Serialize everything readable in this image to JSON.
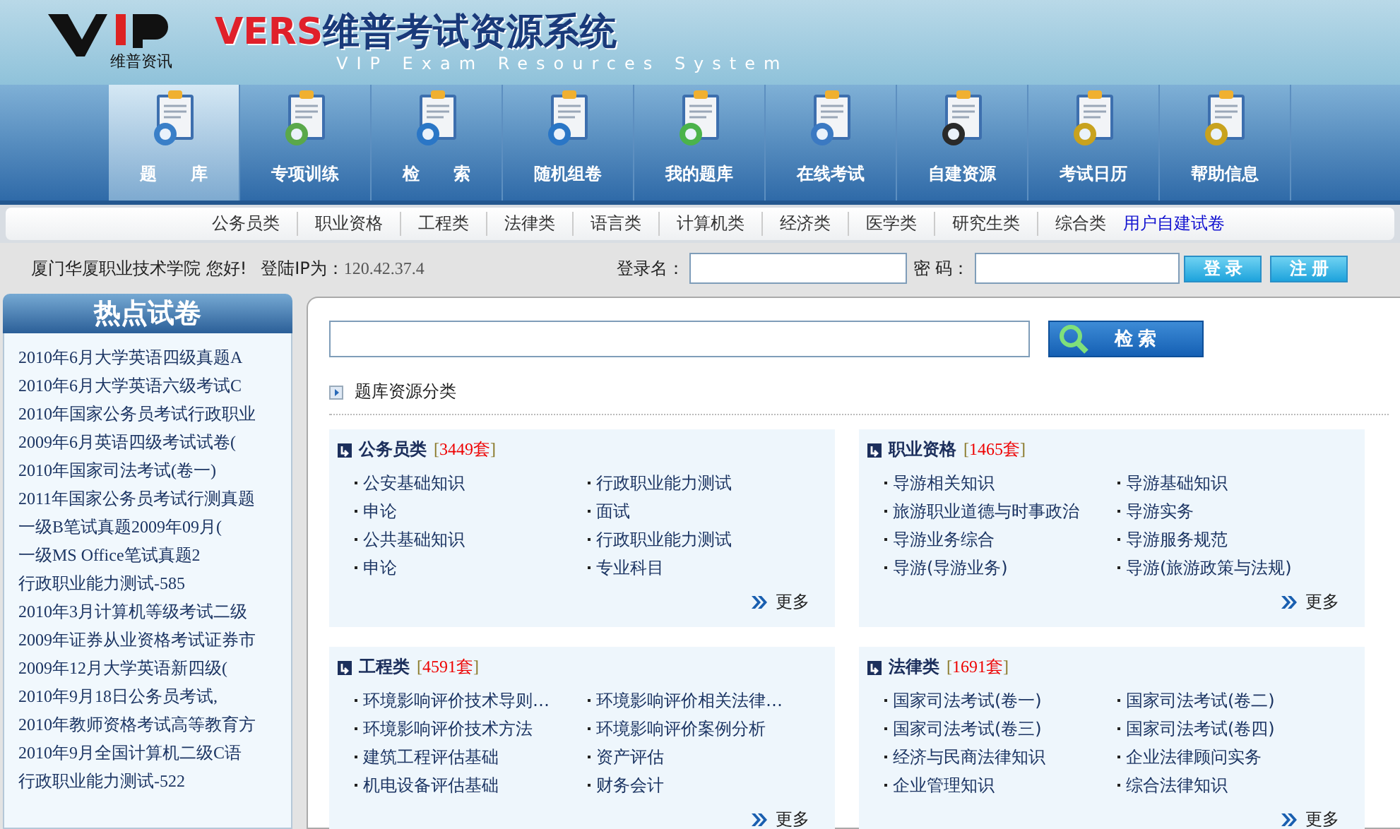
{
  "header": {
    "logo_text": "维普资讯",
    "title_latin": "VERS",
    "title_cn": "维普考试资源系统",
    "subtitle": "VIP Exam Resources System"
  },
  "nav": [
    {
      "label": "题　　库",
      "selected": true
    },
    {
      "label": "专项训练",
      "selected": false
    },
    {
      "label": "检　　索",
      "selected": false
    },
    {
      "label": "随机组卷",
      "selected": false
    },
    {
      "label": "我的题库",
      "selected": false
    },
    {
      "label": "在线考试",
      "selected": false
    },
    {
      "label": "自建资源",
      "selected": false
    },
    {
      "label": "考试日历",
      "selected": false
    },
    {
      "label": "帮助信息",
      "selected": false
    }
  ],
  "subnav": [
    {
      "label": "公务员类",
      "kind": "category"
    },
    {
      "label": "职业资格",
      "kind": "category"
    },
    {
      "label": "工程类",
      "kind": "category"
    },
    {
      "label": "法律类",
      "kind": "category"
    },
    {
      "label": "语言类",
      "kind": "category"
    },
    {
      "label": "计算机类",
      "kind": "category"
    },
    {
      "label": "经济类",
      "kind": "category"
    },
    {
      "label": "医学类",
      "kind": "category"
    },
    {
      "label": "研究生类",
      "kind": "category"
    },
    {
      "label": "综合类",
      "kind": "category"
    },
    {
      "label": "用户自建试卷",
      "kind": "link"
    }
  ],
  "login": {
    "greeting": "厦门华厦职业技术学院 您好!",
    "ip_label": "登陆IP为：",
    "ip": "120.42.37.4",
    "user_label": "登录名：",
    "password_label": "密 码：",
    "login_button": "登 录",
    "register_button": "注 册"
  },
  "sidebar": {
    "title": "热点试卷",
    "items": [
      "2010年6月大学英语四级真题A",
      "2010年6月大学英语六级考试C",
      "2010年国家公务员考试行政职业",
      "2009年6月英语四级考试试卷(",
      "2010年国家司法考试(卷一)",
      "2011年国家公务员考试行测真题",
      "一级B笔试真题2009年09月(",
      "一级MS Office笔试真题2",
      "行政职业能力测试-585",
      "2010年3月计算机等级考试二级",
      "2009年证券从业资格考试证券市",
      "2009年12月大学英语新四级(",
      "2010年9月18日公务员考试,",
      "2010年教师资格考试高等教育方",
      "2010年9月全国计算机二级C语",
      "行政职业能力测试-522"
    ]
  },
  "search": {
    "button": "检 索"
  },
  "section_title": "题库资源分类",
  "categories": [
    {
      "title": "公务员类",
      "count": "[3449套]",
      "items": [
        "公安基础知识",
        "行政职业能力测试",
        "申论",
        "面试",
        "公共基础知识",
        "行政职业能力测试",
        "申论",
        "专业科目"
      ],
      "more": "更多"
    },
    {
      "title": "职业资格",
      "count": "[1465套]",
      "items": [
        "导游相关知识",
        "导游基础知识",
        "旅游职业道德与时事政治",
        "导游实务",
        "导游业务综合",
        "导游服务规范",
        "导游(导游业务)",
        "导游(旅游政策与法规)"
      ],
      "more": "更多"
    },
    {
      "title": "工程类",
      "count": "[4591套]",
      "items": [
        "环境影响评价技术导则…",
        "环境影响评价相关法律…",
        "环境影响评价技术方法",
        "环境影响评价案例分析",
        "建筑工程评估基础",
        "资产评估",
        "机电设备评估基础",
        "财务会计"
      ],
      "more": "更多"
    },
    {
      "title": "法律类",
      "count": "[1691套]",
      "items": [
        "国家司法考试(卷一)",
        "国家司法考试(卷二)",
        "国家司法考试(卷三)",
        "国家司法考试(卷四)",
        "经济与民商法律知识",
        "企业法律顾问实务",
        "企业管理知识",
        "综合法律知识"
      ],
      "more": "更多"
    }
  ]
}
